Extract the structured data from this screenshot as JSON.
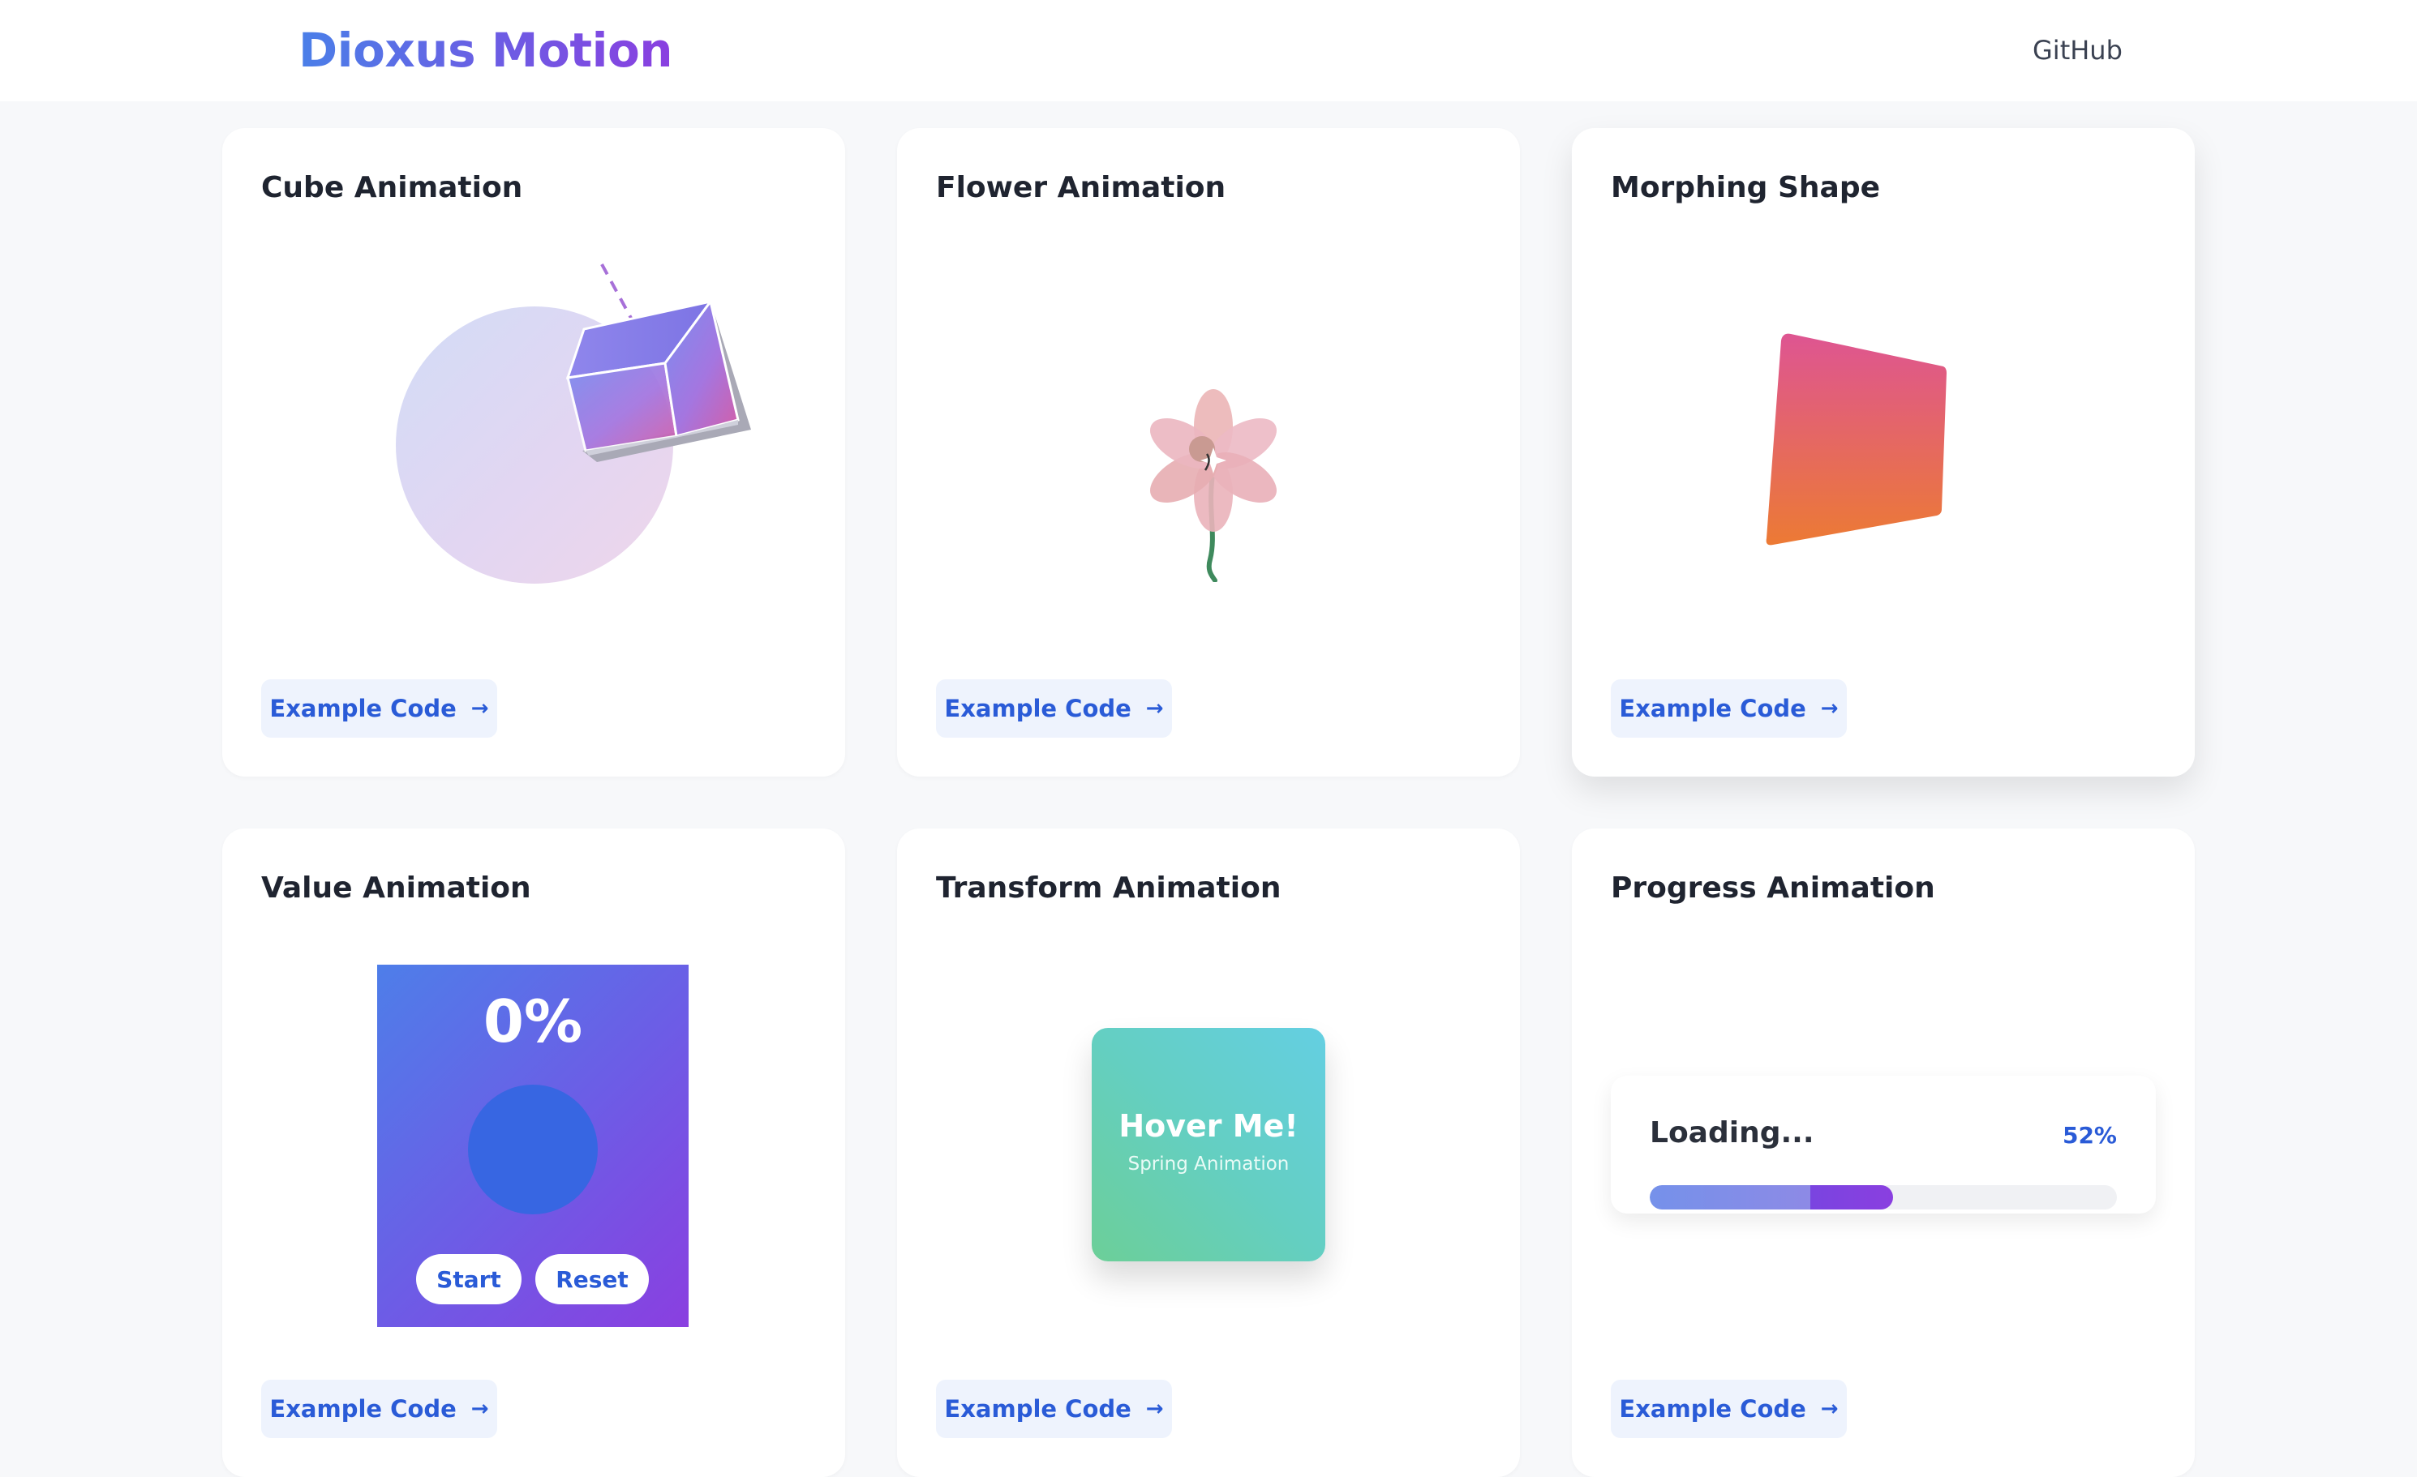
{
  "header": {
    "brand": "Dioxus Motion",
    "github_label": "GitHub"
  },
  "cards": {
    "cube": {
      "title": "Cube Animation",
      "button": "Example Code"
    },
    "flower": {
      "title": "Flower Animation",
      "button": "Example Code"
    },
    "morph": {
      "title": "Morphing Shape",
      "button": "Example Code"
    },
    "value": {
      "title": "Value Animation",
      "percent": "0%",
      "start_label": "Start",
      "reset_label": "Reset",
      "button": "Example Code"
    },
    "transform": {
      "title": "Transform Animation",
      "hover_title": "Hover Me!",
      "hover_subtitle": "Spring Animation",
      "button": "Example Code"
    },
    "progress": {
      "title": "Progress Animation",
      "label": "Loading...",
      "value_text": "52%",
      "value": 0.52,
      "button": "Example Code"
    }
  },
  "icons": {
    "code_button": "arrow-right-icon"
  },
  "colors": {
    "accent": "#2a5bd7",
    "brand_start": "#4a7fe8",
    "brand_end": "#8a3fe0",
    "button_bg": "#eef3fd",
    "morph_top": "#de5592",
    "morph_bottom": "#ec7a34"
  }
}
